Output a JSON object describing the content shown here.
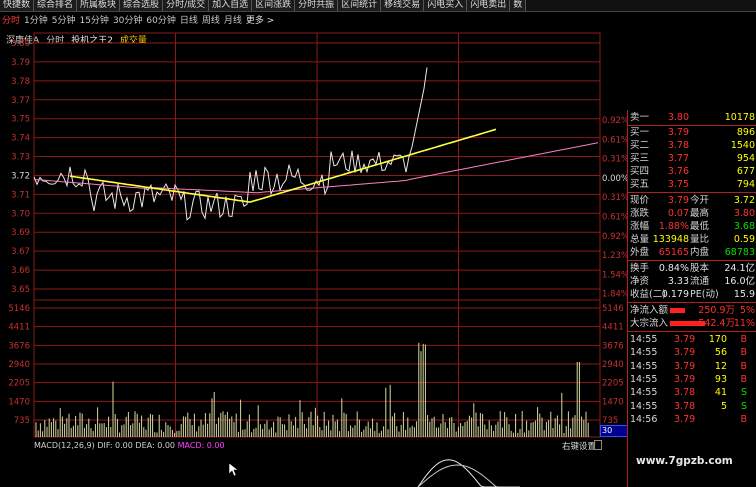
{
  "toolbar": [
    "快捷数",
    "综合排名",
    "所属板块",
    "综合选股",
    "分时/成交",
    "加入自选",
    "区间涨跌",
    "分时共振",
    "区间统计",
    "移线交易",
    "闪电买入",
    "闪电卖出",
    "数"
  ],
  "periods": [
    {
      "label": "分时",
      "active": true
    },
    {
      "label": "1分钟",
      "active": false
    },
    {
      "label": "5分钟",
      "active": false
    },
    {
      "label": "15分钟",
      "active": false
    },
    {
      "label": "30分钟",
      "active": false
    },
    {
      "label": "60分钟",
      "active": false
    },
    {
      "label": "日线",
      "active": false
    },
    {
      "label": "周线",
      "active": false
    },
    {
      "label": "月线",
      "active": false
    },
    {
      "label": "更多 >",
      "active": false
    }
  ],
  "header": {
    "stock_name": "深康佳A",
    "chart_type": "分时",
    "indicator": "投机之王2",
    "volume_label": "成交量"
  },
  "price_axis": {
    "left": [
      "3.80",
      "3.79",
      "3.78",
      "3.77",
      "3.75",
      "3.74",
      "3.73",
      "3.72",
      "3.71",
      "3.70",
      "3.69",
      "3.67",
      "3.66",
      "3.65"
    ],
    "right": [
      "0.92%",
      "0.61%",
      "0.31%",
      "0.00%",
      "0.31%",
      "0.61%",
      "0.92%",
      "1.23%",
      "1.54%",
      "1.84%"
    ],
    "mid_left": "3.72",
    "mid_right": "0.00%"
  },
  "volume_axis": [
    "5146",
    "4411",
    "3676",
    "2940",
    "2205",
    "1470",
    "735"
  ],
  "volume_right_extra": "30",
  "macd": {
    "name": "MACD(12,26,9)",
    "dif": "DIF: 0.00",
    "dea": "DEA: 0.00",
    "macd": "MACD: 0.00"
  },
  "right_button": "右键设置",
  "quotes": {
    "sells": [
      {
        "label": "卖一",
        "price": "3.80",
        "vol": "10178"
      }
    ],
    "buys": [
      {
        "label": "买一",
        "price": "3.79",
        "vol": "896"
      },
      {
        "label": "买二",
        "price": "3.78",
        "vol": "1540"
      },
      {
        "label": "买三",
        "price": "3.77",
        "vol": "954"
      },
      {
        "label": "买四",
        "price": "3.76",
        "vol": "677"
      },
      {
        "label": "买五",
        "price": "3.75",
        "vol": "794"
      }
    ]
  },
  "stats": [
    {
      "l1": "现价",
      "v1": "3.79",
      "l2": "今开",
      "v2": "3.72"
    },
    {
      "l1": "涨跌",
      "v1": "0.07",
      "l2": "最高",
      "v2": "3.80"
    },
    {
      "l1": "涨幅",
      "v1": "1.88%",
      "l2": "最低",
      "v2": "3.68"
    },
    {
      "l1": "总量",
      "v1": "133948",
      "l2": "量比",
      "v2": "0.59"
    },
    {
      "l1": "外盘",
      "v1": "65165",
      "l2": "内盘",
      "v2": "68783"
    }
  ],
  "stats2": [
    {
      "l1": "换手",
      "v1": "0.84%",
      "l2": "股本",
      "v2": "24.1亿"
    },
    {
      "l1": "净资",
      "v1": "3.33",
      "l2": "流通",
      "v2": "16.0亿"
    },
    {
      "l1": "收益(二)",
      "v1": "0.179",
      "l2": "PE(动)",
      "v2": "15.9"
    }
  ],
  "flows": [
    {
      "label": "净流入额",
      "value": "250.9万",
      "pct": "5%",
      "bar": 0.15
    },
    {
      "label": "大宗流入",
      "value": "542.4万",
      "pct": "11%",
      "bar": 0.35
    }
  ],
  "ticks": [
    {
      "time": "14:55",
      "price": "3.79",
      "vol": "170",
      "side": "B"
    },
    {
      "time": "14:55",
      "price": "3.79",
      "vol": "56",
      "side": "B"
    },
    {
      "time": "14:55",
      "price": "3.79",
      "vol": "12",
      "side": "B"
    },
    {
      "time": "14:55",
      "price": "3.79",
      "vol": "93",
      "side": "B"
    },
    {
      "time": "14:55",
      "price": "3.78",
      "vol": "41",
      "side": "S"
    },
    {
      "time": "14:55",
      "price": "3.78",
      "vol": "5",
      "side": "S"
    },
    {
      "time": "14:56",
      "price": "3.79",
      "vol": "",
      "side": "B"
    }
  ],
  "watermark": "www.7gpzb.com",
  "colors": {
    "grid": "#8b1a1a",
    "price": "#e8e8e8",
    "avg": "#ffff40",
    "ma": "#ff80c0",
    "vol": "#d8d8a0",
    "up": "#ff3030",
    "down": "#00e000"
  }
}
